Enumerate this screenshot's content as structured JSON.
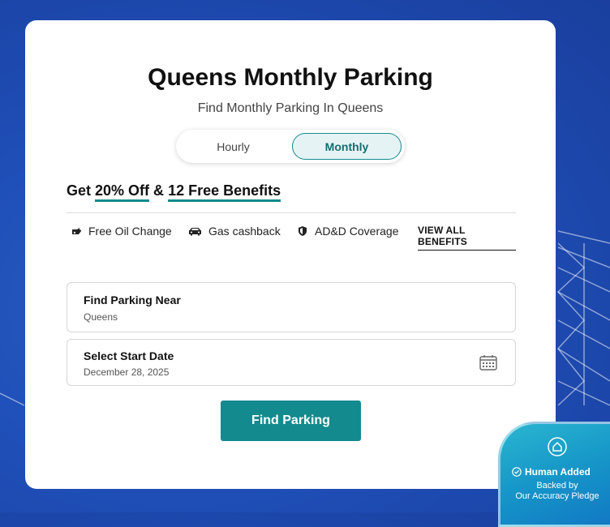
{
  "title": "Queens Monthly Parking",
  "subtitle": "Find Monthly Parking In Queens",
  "toggle": {
    "hourly": "Hourly",
    "monthly": "Monthly",
    "selected": "Monthly"
  },
  "offer": {
    "prefix": "Get ",
    "discount": "20% Off",
    "amp": " & ",
    "benefits": "12 Free Benefits"
  },
  "benefits": [
    {
      "label": "Free Oil Change",
      "icon": "oil-can-icon"
    },
    {
      "label": "Gas cashback",
      "icon": "car-icon"
    },
    {
      "label": "AD&D Coverage",
      "icon": "shield-icon"
    }
  ],
  "view_all": "VIEW ALL BENEFITS",
  "location": {
    "label": "Find Parking Near",
    "value": "Queens"
  },
  "start_date": {
    "label": "Select Start Date",
    "value": "December 28, 2025",
    "icon": "calendar-icon"
  },
  "find_button": "Find Parking",
  "badge": {
    "title": "Human Added",
    "line1": "Backed by",
    "line2": "Our Accuracy Pledge"
  },
  "colors": {
    "accent": "#138a8d",
    "background": "#1f4fb8"
  }
}
